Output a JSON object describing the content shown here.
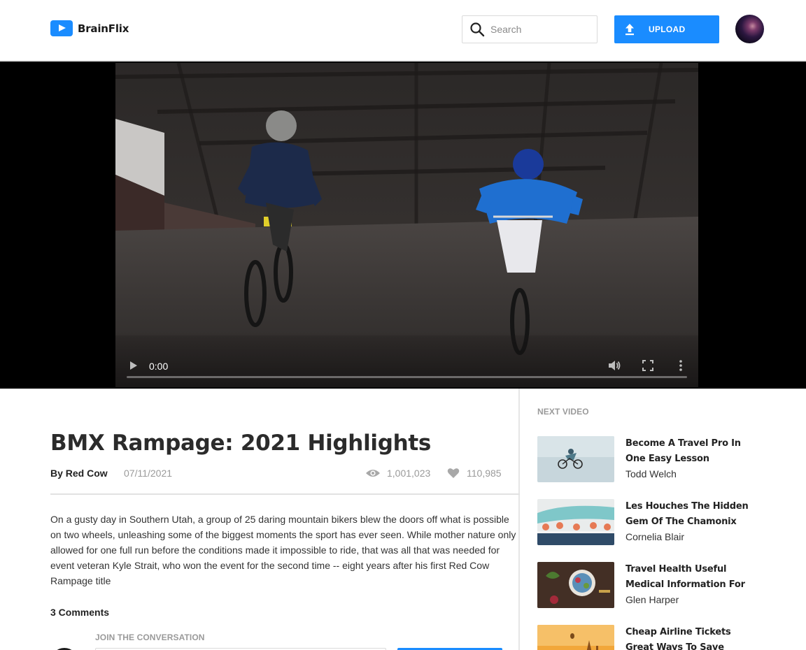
{
  "header": {
    "logo_text": "BrainFlix",
    "search_placeholder": "Search",
    "upload_label": "UPLOAD"
  },
  "player": {
    "current_time": "0:00",
    "progress": 0
  },
  "video": {
    "title": "BMX Rampage: 2021 Highlights",
    "author": "By Red Cow",
    "date": "07/11/2021",
    "views": "1,001,023",
    "likes": "110,985",
    "description": "On a gusty day in Southern Utah, a group of 25 daring mountain bikers blew the doors off what is possible on two wheels, unleashing some of the biggest moments the sport has ever seen. While mother nature only allowed for one full run before the conditions made it impossible to ride, that was all that was needed for event veteran Kyle Strait, who won the event for the second time -- eight years after his first Red Cow Rampage title"
  },
  "comments": {
    "count_label": "3 Comments",
    "join_label": "JOIN THE CONVERSATION"
  },
  "sidebar": {
    "heading": "NEXT VIDEO",
    "items": [
      {
        "title": "Become A Travel Pro In One Easy Lesson",
        "author": "Todd Welch"
      },
      {
        "title": "Les Houches The Hidden Gem Of The Chamonix",
        "author": "Cornelia Blair"
      },
      {
        "title": "Travel Health Useful Medical Information For",
        "author": "Glen Harper"
      },
      {
        "title": "Cheap Airline Tickets Great Ways To Save",
        "author": ""
      }
    ]
  },
  "colors": {
    "accent": "#1a8cff",
    "muted_text": "#9a9a9a",
    "divider": "#e6e6e6"
  }
}
